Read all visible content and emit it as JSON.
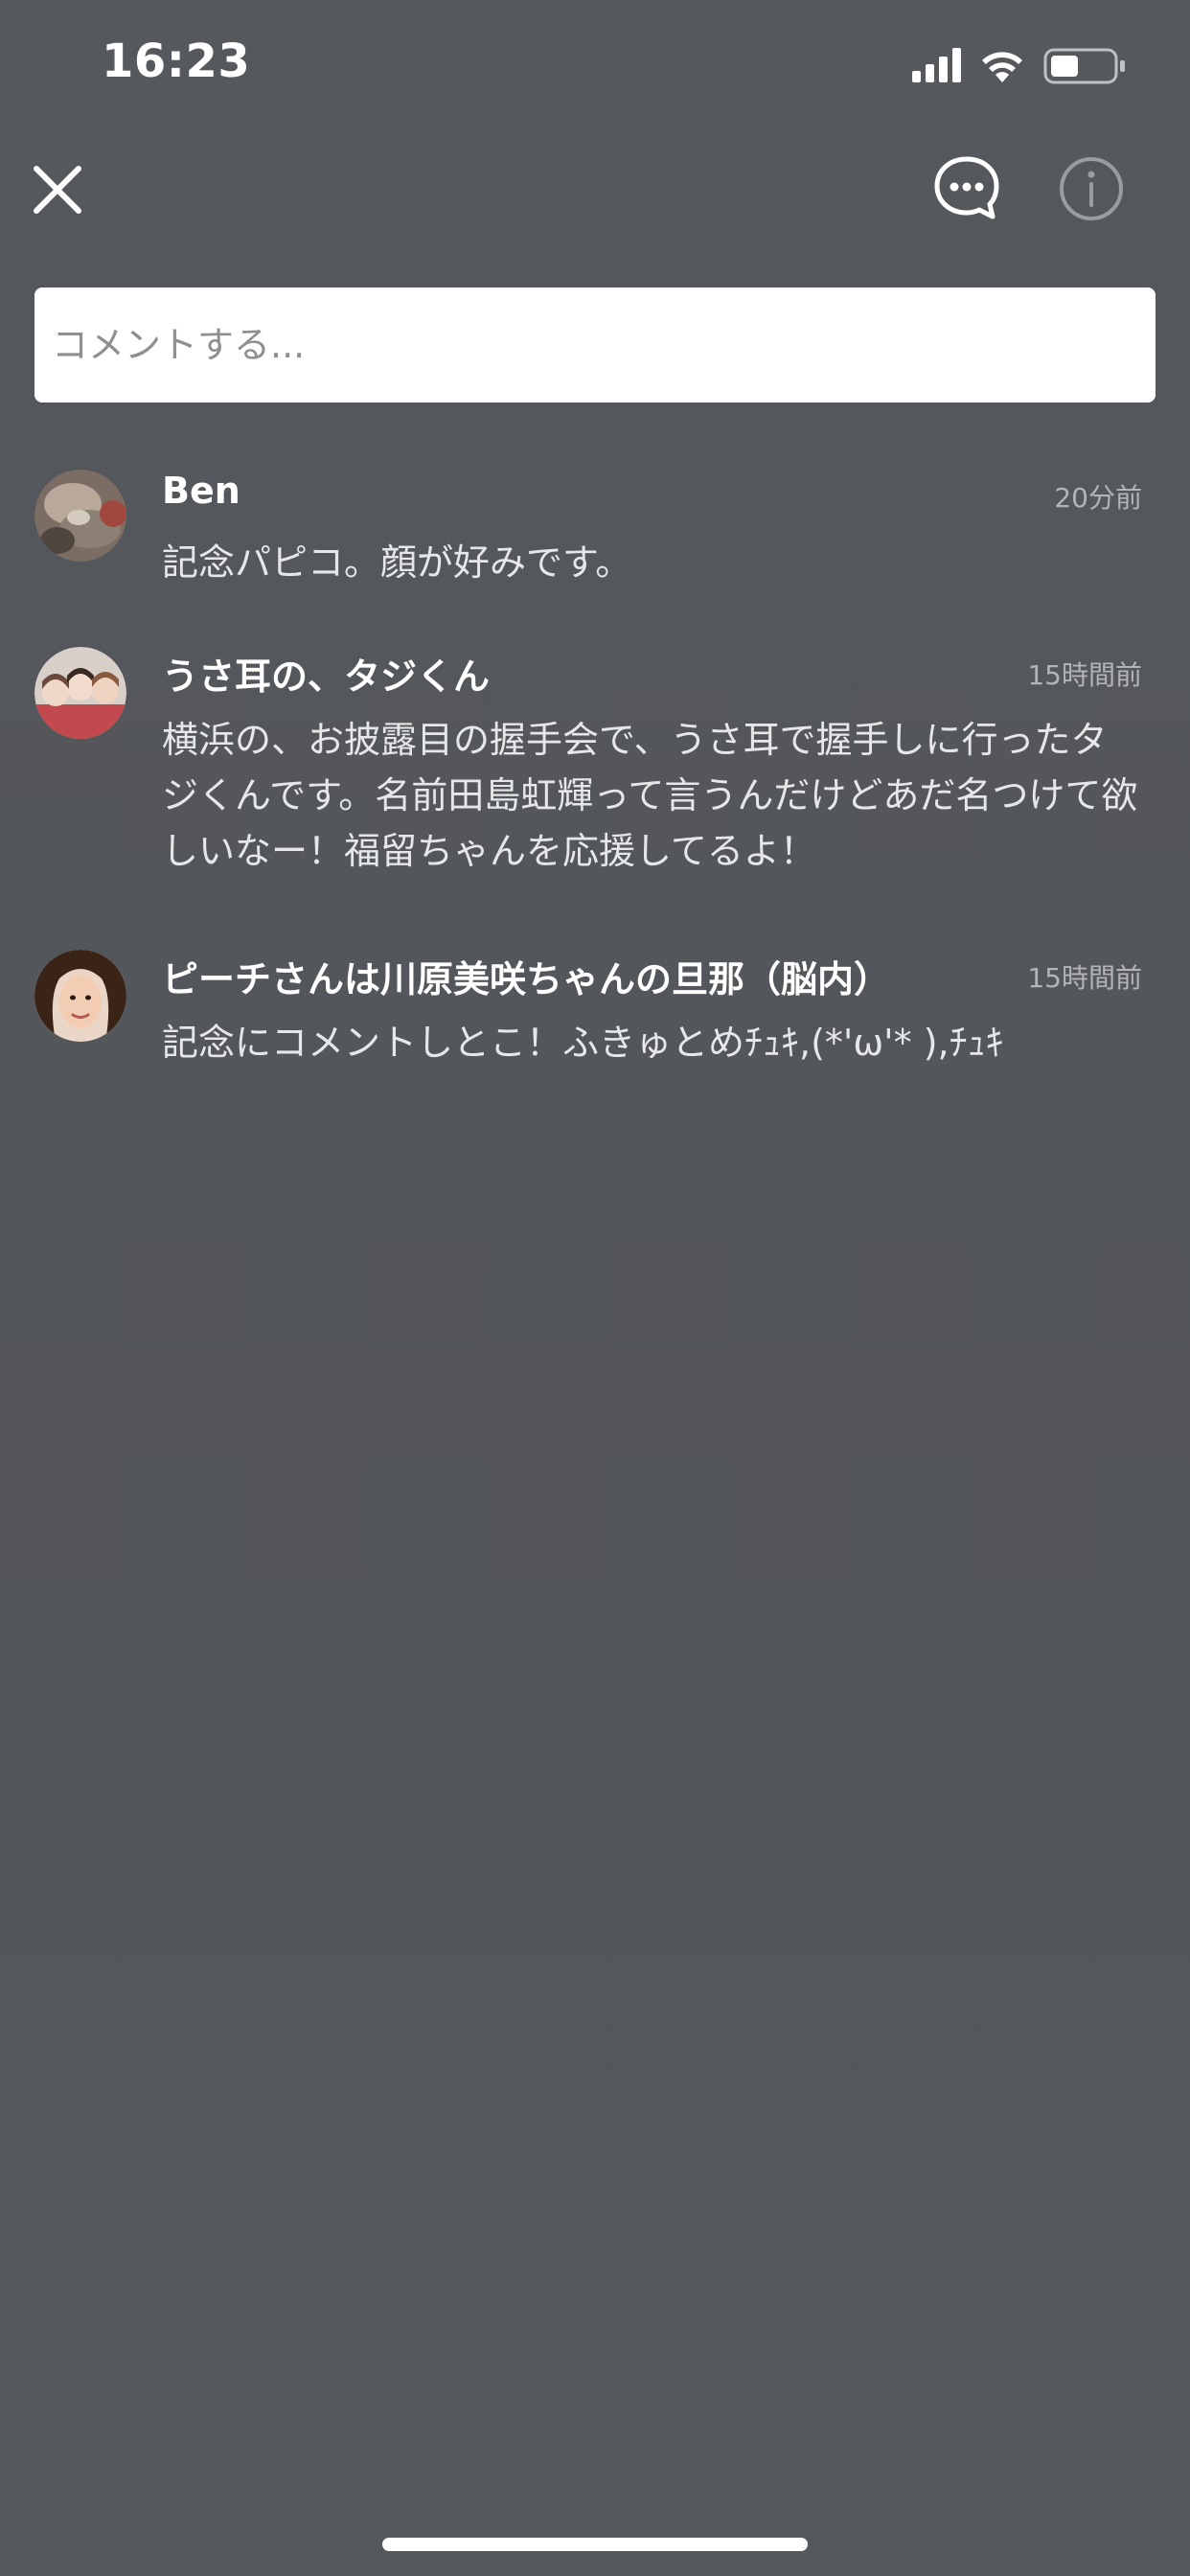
{
  "status_bar": {
    "time": "16:23"
  },
  "nav": {
    "close_icon": "close-icon",
    "comment_icon": "speech-bubble-icon",
    "info_icon": "info-icon"
  },
  "input": {
    "placeholder": "コメントする..."
  },
  "comments": [
    {
      "name": "Ben",
      "time": "20分前",
      "text": "記念パピコ。顔が好みです。"
    },
    {
      "name": "うさ耳の、タジくん",
      "time": "15時間前",
      "text": "横浜の、お披露目の握手会で、うさ耳で握手しに行ったタジくんです。名前田島虹輝って言うんだけどあだ名つけて欲しいなー！福留ちゃんを応援してるよ！"
    },
    {
      "name": "ピーチさんは川原美咲ちゃんの旦那（脳内）",
      "time": "15時間前",
      "text": "記念にコメントしとこ！ふきゅとめﾁｭｷ,(*'ω'* ),ﾁｭｷ"
    }
  ],
  "colors": {
    "background": "#53565a",
    "text_primary": "#ffffff",
    "text_secondary": "#b2b4b7"
  }
}
